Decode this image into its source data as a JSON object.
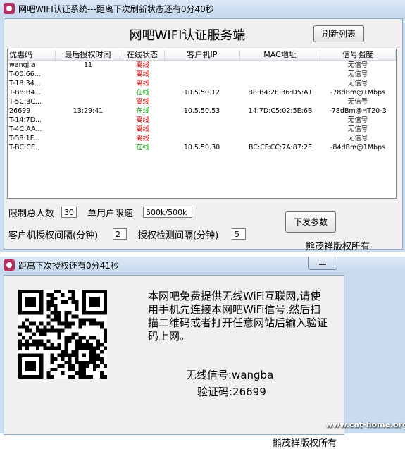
{
  "main_window": {
    "title": "网吧WIFI认证系统---距离下次刷新状态还有0分40秒",
    "app_title": "网吧WIFI认证服务端",
    "refresh_label": "刷新列表",
    "columns": [
      "优惠码",
      "最后授权时间",
      "在线状态",
      "客户机IP",
      "MAC地址",
      "信号强度"
    ],
    "rows": [
      {
        "code": "wangjia",
        "time": "11",
        "status": "离线",
        "ip": "",
        "mac": "",
        "signal": "无信号",
        "online": false
      },
      {
        "code": "T-00:66...",
        "time": "",
        "status": "离线",
        "ip": "",
        "mac": "",
        "signal": "无信号",
        "online": false
      },
      {
        "code": "T-18:34...",
        "time": "",
        "status": "离线",
        "ip": "",
        "mac": "",
        "signal": "无信号",
        "online": false
      },
      {
        "code": "T-B8:B4...",
        "time": "",
        "status": "在线",
        "ip": "10.5.50.12",
        "mac": "B8:B4:2E:36:D5:A1",
        "signal": "-78dBm@1Mbps",
        "online": true
      },
      {
        "code": "T-5C:3C...",
        "time": "",
        "status": "离线",
        "ip": "",
        "mac": "",
        "signal": "无信号",
        "online": false
      },
      {
        "code": "26699",
        "time": "13:29:41",
        "status": "在线",
        "ip": "10.5.50.53",
        "mac": "14:7D:C5:02:5E:6B",
        "signal": "-78dBm@HT20-3",
        "online": true
      },
      {
        "code": "T-14:7D...",
        "time": "",
        "status": "离线",
        "ip": "",
        "mac": "",
        "signal": "无信号",
        "online": false
      },
      {
        "code": "T-4C:AA...",
        "time": "",
        "status": "离线",
        "ip": "",
        "mac": "",
        "signal": "无信号",
        "online": false
      },
      {
        "code": "T-58:1F...",
        "time": "",
        "status": "离线",
        "ip": "",
        "mac": "",
        "signal": "无信号",
        "online": false
      },
      {
        "code": "T-BC:CF...",
        "time": "",
        "status": "在线",
        "ip": "10.5.50.30",
        "mac": "BC:CF:CC:7A:87:2E",
        "signal": "-84dBm@1Mbps",
        "online": true
      }
    ],
    "limit_total_label": "限制总人数",
    "limit_total_value": "30",
    "speed_label": "单用户限速",
    "speed_value": "500k/500k",
    "auth_interval_label": "客户机授权间隔(分钟)",
    "auth_interval_value": "2",
    "check_interval_label": "授权检测间隔(分钟)",
    "check_interval_value": "5",
    "send_label": "下发参数",
    "copyright": "熊茂祥版权所有"
  },
  "qr_window": {
    "title": "距离下次授权还有0分41秒",
    "description": "本网吧免费提供无线WiFi互联网,请使用手机先连接本网吧WiFi信号,然后扫描二维码或者打开任意网站后输入验证码上网。",
    "ssid_line": "无线信号:wangba",
    "code_line": "验证码:26699",
    "copyright": "熊茂祥版权所有"
  },
  "watermark": "www.cat-home.org",
  "colors": {
    "offline": "#cc0000",
    "online": "#009900",
    "window_frame": "#c9dcef"
  }
}
